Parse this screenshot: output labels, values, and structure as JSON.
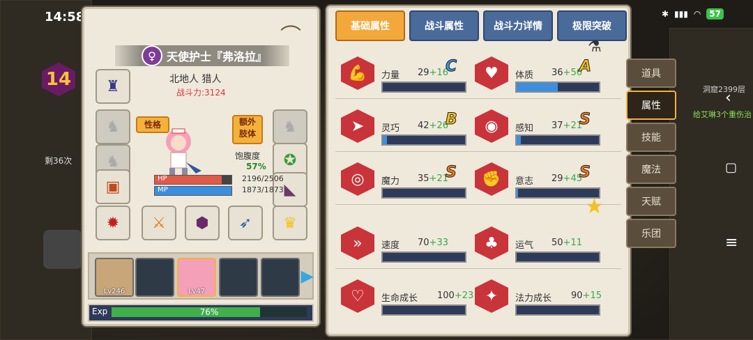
{
  "status": {
    "time": "14:58",
    "battery": "57"
  },
  "world": {
    "level": "14",
    "remaining": "剩36次",
    "floor": "洞窟2399层",
    "injury": "给艾琳3个重伤治"
  },
  "character": {
    "name": "天使护士『弗洛拉』",
    "origin": "北地人  猎人",
    "power": "战斗力:3124",
    "tag_personality": "性格",
    "tag_extra": "额外\n肢体",
    "hunger_label": "饱腹度",
    "hunger_value": "57%",
    "hp_label": "HP",
    "hp_value": "2196/2506",
    "hp_fraction": 0.876,
    "mp_label": "MP",
    "mp_value": "1873/1873",
    "mp_fraction": 1.0
  },
  "party": [
    {
      "level": "Lv246",
      "filled": true
    },
    {
      "level": "",
      "filled": false
    },
    {
      "level": "Lv47",
      "filled": true
    },
    {
      "level": "",
      "filled": false
    },
    {
      "level": "",
      "filled": false
    }
  ],
  "exp": {
    "label": "Exp",
    "value": "76%",
    "fraction": 0.76
  },
  "tabs": [
    {
      "label": "基础属性",
      "active": true
    },
    {
      "label": "战斗属性",
      "active": false
    },
    {
      "label": "战斗力详情",
      "active": false
    },
    {
      "label": "极限突破",
      "active": false
    }
  ],
  "stats": [
    {
      "name": "力量",
      "base": "29",
      "bonus": "+16",
      "grade": "C",
      "grade_color": "#3a8fe0",
      "fill": 0.0,
      "icon": "strength-icon"
    },
    {
      "name": "体质",
      "base": "36",
      "bonus": "+56",
      "grade": "A",
      "grade_color": "#f5c218",
      "fill": 0.5,
      "icon": "constitution-icon"
    },
    {
      "name": "灵巧",
      "base": "42",
      "bonus": "+26",
      "grade": "B",
      "grade_color": "#f5c218",
      "fill": 0.05,
      "icon": "agility-icon"
    },
    {
      "name": "感知",
      "base": "37",
      "bonus": "+21",
      "grade": "S",
      "grade_color": "#f27a1a",
      "fill": 0.05,
      "icon": "perception-icon"
    },
    {
      "name": "魔力",
      "base": "35",
      "bonus": "+21",
      "grade": "S",
      "grade_color": "#f27a1a",
      "fill": 0.0,
      "icon": "magic-icon"
    },
    {
      "name": "意志",
      "base": "29",
      "bonus": "+45",
      "grade": "S",
      "grade_color": "#f27a1a",
      "fill": 0.02,
      "icon": "will-icon"
    },
    {
      "name": "速度",
      "base": "70",
      "bonus": "+33",
      "grade": "",
      "grade_color": "",
      "fill": 0.0,
      "icon": "speed-icon"
    },
    {
      "name": "运气",
      "base": "50",
      "bonus": "+11",
      "grade": "",
      "grade_color": "",
      "fill": 0.0,
      "icon": "luck-icon"
    },
    {
      "name": "生命成长",
      "base": "100",
      "bonus": "+23",
      "grade": "",
      "grade_color": "",
      "fill": 0.0,
      "icon": "life-growth-icon"
    },
    {
      "name": "法力成长",
      "base": "90",
      "bonus": "+15",
      "grade": "",
      "grade_color": "",
      "fill": 0.0,
      "icon": "mana-growth-icon"
    }
  ],
  "side_tabs": [
    {
      "label": "道具",
      "active": false
    },
    {
      "label": "属性",
      "active": true
    },
    {
      "label": "技能",
      "active": false
    },
    {
      "label": "魔法",
      "active": false
    },
    {
      "label": "天赋",
      "active": false
    },
    {
      "label": "乐团",
      "active": false
    }
  ],
  "colors": {
    "accent": "#f2a83a",
    "stat_icon": "#c8343a",
    "bonus": "#3aa64a",
    "hp": "#e05a4a",
    "mp": "#3a8fe0",
    "exp": "#3fb04a"
  }
}
